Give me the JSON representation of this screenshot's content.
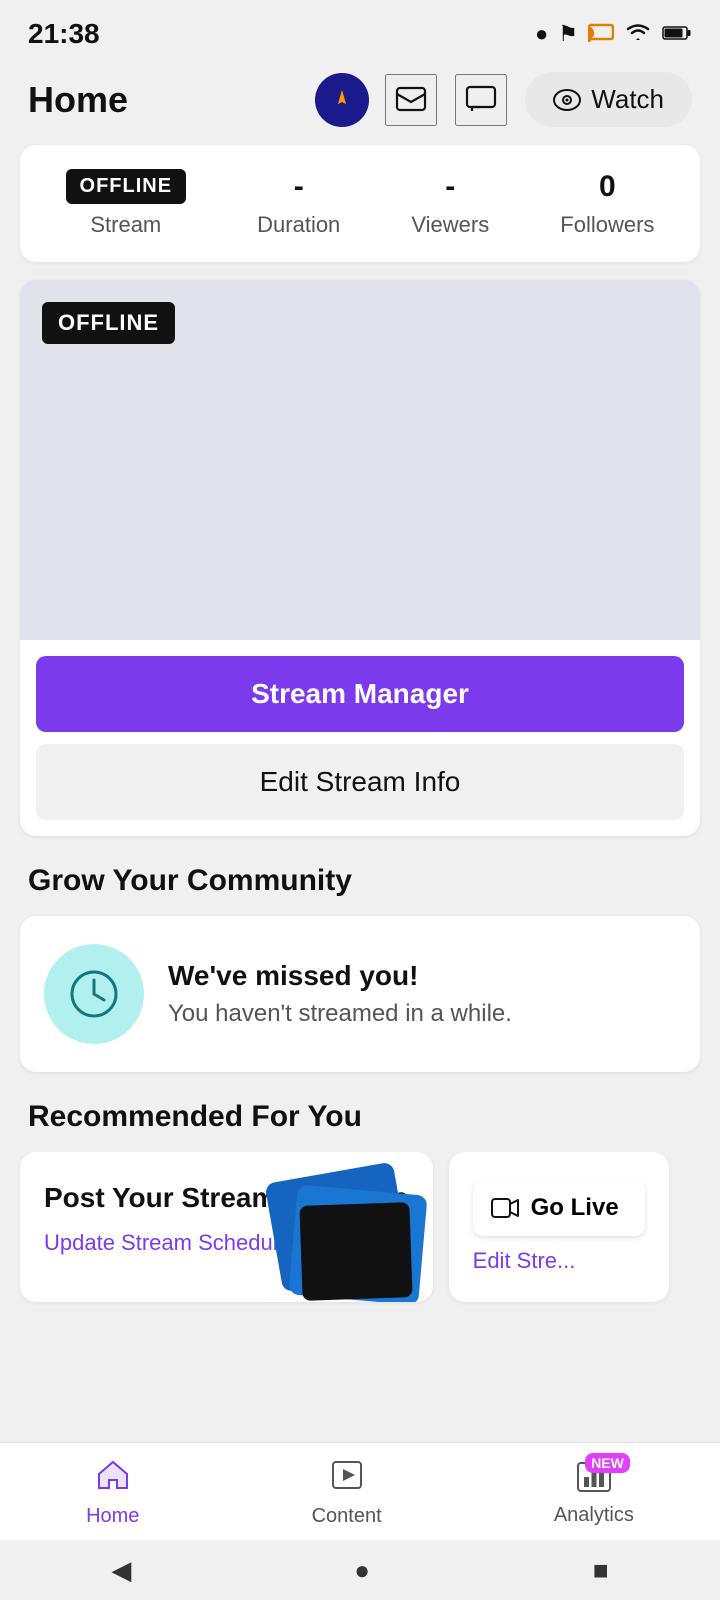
{
  "statusBar": {
    "time": "21:38",
    "icons": [
      "●",
      "!",
      "cast",
      "wifi",
      "battery"
    ]
  },
  "header": {
    "title": "Home",
    "watchLabel": "Watch"
  },
  "stats": {
    "offlineLabel": "OFFLINE",
    "streamLabel": "Stream",
    "durationValue": "-",
    "durationLabel": "Duration",
    "viewersValue": "-",
    "viewersLabel": "Viewers",
    "followersValue": "0",
    "followersLabel": "Followers"
  },
  "preview": {
    "offlineBadge": "OFFLINE",
    "streamManagerLabel": "Stream Manager",
    "editStreamLabel": "Edit Stream Info"
  },
  "grow": {
    "sectionTitle": "Grow Your Community",
    "headline": "We've missed you!",
    "subtext": "You haven't streamed in a while."
  },
  "recommended": {
    "sectionTitle": "Recommended For You",
    "card1Title": "Post Your Stream Schedule",
    "card1Link": "Update Stream Schedule",
    "card2Title": "Go Live",
    "card2Link": "Edit Stre..."
  },
  "bottomNav": {
    "homeLabel": "Home",
    "contentLabel": "Content",
    "analyticsLabel": "Analytics",
    "newBadge": "NEW"
  },
  "androidNav": {
    "back": "◀",
    "home": "●",
    "recent": "■"
  }
}
